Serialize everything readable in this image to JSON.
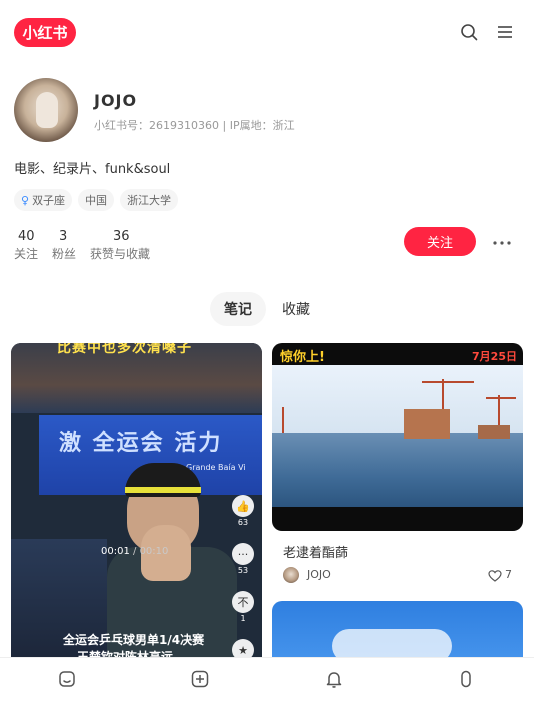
{
  "app": {
    "logo_text": "小红书"
  },
  "topbar": {
    "search_icon": "search-icon",
    "menu_icon": "menu-icon"
  },
  "profile": {
    "nickname": "JOJO",
    "red_id_label": "小红书号：",
    "red_id": "2619310360",
    "ip_label": "IP属地：",
    "ip_location": "浙江",
    "bio": "电影、纪录片、funk&soul",
    "tags": [
      {
        "label": "双子座",
        "icon": "gender-female-icon"
      },
      {
        "label": "中国"
      },
      {
        "label": "浙江大学"
      }
    ],
    "stats": [
      {
        "num": "40",
        "label": "关注"
      },
      {
        "num": "3",
        "label": "粉丝"
      },
      {
        "num": "36",
        "label": "获赞与收藏"
      }
    ],
    "follow_label": "关注"
  },
  "tabs": [
    {
      "label": "笔记",
      "active": true
    },
    {
      "label": "收藏",
      "active": false
    }
  ],
  "notes": [
    {
      "kind": "video",
      "overlay_top": "比赛中也多次清嗓子",
      "banner_text": "激 全运会 活力",
      "banner_sub": "Grande Baía Vi",
      "time_current": "00:01",
      "time_total": "00:10",
      "caption_line1": "全运会乒乓球男单1/4决赛",
      "caption_line2": "王楚钦对陈林高远",
      "side": [
        {
          "icon": "thumb-up-icon",
          "count": "63"
        },
        {
          "icon": "comment-icon",
          "count": "53"
        },
        {
          "icon": "dislike-icon",
          "count": "1"
        },
        {
          "icon": "star-icon",
          "count": ""
        }
      ]
    },
    {
      "kind": "image",
      "overlay_top": "惊你上!",
      "overlay_date": "7月25日",
      "title": "老逮着酯蒒",
      "author": "JOJO",
      "likes": "7"
    },
    {
      "kind": "image"
    }
  ],
  "bottom_nav": [
    {
      "icon": "home-icon"
    },
    {
      "icon": "add-icon"
    },
    {
      "icon": "notification-icon"
    },
    {
      "icon": "profile-icon"
    }
  ],
  "colors": {
    "brand": "#ff2442"
  }
}
